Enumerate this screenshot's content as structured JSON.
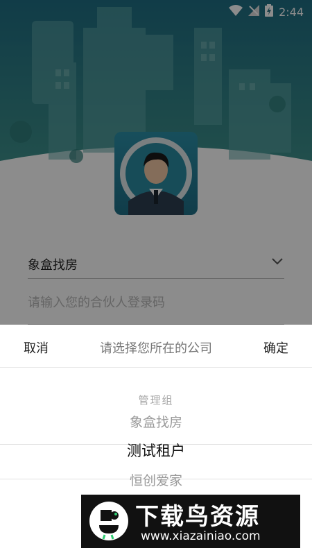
{
  "status_bar": {
    "time": "2:44"
  },
  "login_form": {
    "company_value": "象盒找房",
    "code_placeholder": "请输入您的合伙人登录码"
  },
  "picker_sheet": {
    "cancel_label": "取消",
    "title": "请选择您所在的公司",
    "confirm_label": "确定",
    "options": [
      "管理组",
      "象盒找房",
      "测试租户",
      "恒创爱家"
    ],
    "selected": "测试租户"
  },
  "watermark": {
    "title": "下载鸟资源",
    "url": "www.xiazainiao.com"
  },
  "colors": {
    "header_teal": "#2f7f86",
    "accent": "#1f6f86"
  }
}
